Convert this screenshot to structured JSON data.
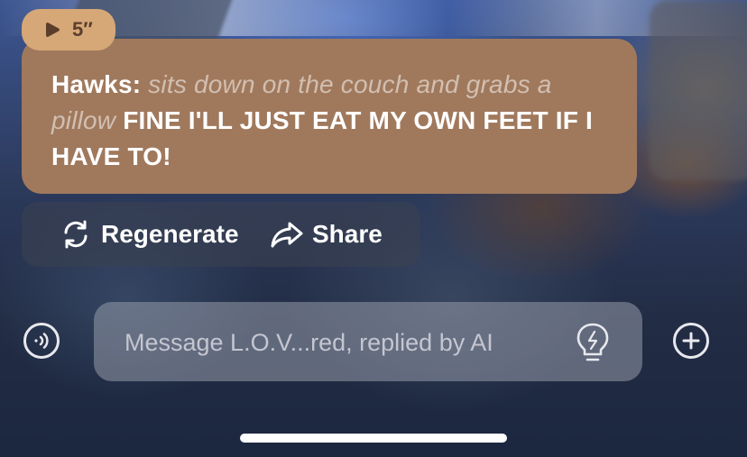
{
  "message": {
    "duration": "5″",
    "speaker": "Hawks:",
    "action": "sits down on the couch and grabs a pillow",
    "text": "FINE I'LL JUST EAT MY OWN FEET IF I HAVE TO!"
  },
  "actions": {
    "regenerate": "Regenerate",
    "share": "Share"
  },
  "composer": {
    "placeholder": "Message L.O.V...red, replied by AI"
  },
  "icons": {
    "play": "play-icon",
    "regenerate": "refresh-icon",
    "share": "share-arrow-icon",
    "voice": "voice-icon",
    "hint": "lightbulb-icon",
    "add": "plus-icon"
  },
  "colors": {
    "bubble": "#a0795d",
    "badge": "#d6a878",
    "action_text": "#d2bfb1"
  }
}
